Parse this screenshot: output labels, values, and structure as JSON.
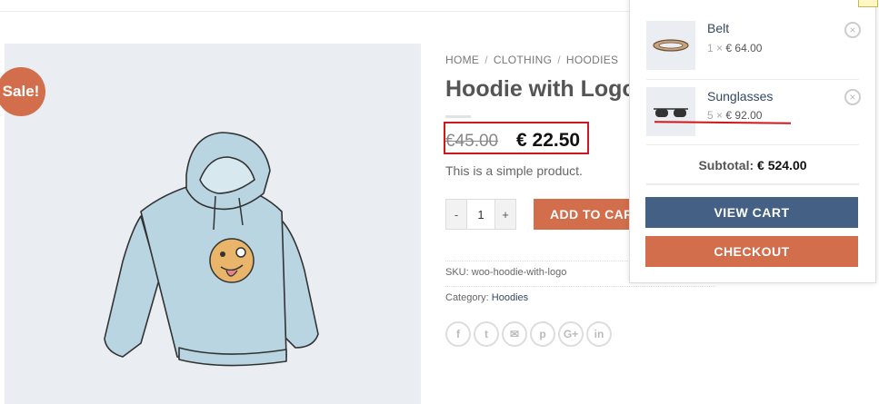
{
  "badge": {
    "sale": "Sale!"
  },
  "breadcrumb": [
    "HOME",
    "CLOTHING",
    "HOODIES"
  ],
  "breadcrumb_sep": "/",
  "product": {
    "title": "Hoodie with Logo",
    "old_price": "€45.00",
    "new_price": "€ 22.50",
    "description": "This is a simple product.",
    "qty": "1",
    "minus": "-",
    "plus": "+",
    "add_to_cart": "ADD TO CART",
    "sku_label": "SKU:",
    "sku": "woo-hoodie-with-logo",
    "category_label": "Category:",
    "category": "Hoodies"
  },
  "share": [
    "f",
    "t",
    "✉",
    "p",
    "G+",
    "in"
  ],
  "cart": {
    "items": [
      {
        "name": "Belt",
        "qty": "1",
        "price": "€ 64.00"
      },
      {
        "name": "Sunglasses",
        "qty": "5",
        "price": "€ 92.00"
      }
    ],
    "times": "×",
    "remove": "×",
    "subtotal_label": "Subtotal:",
    "subtotal": "€ 524.00",
    "view_cart": "VIEW CART",
    "checkout": "CHECKOUT"
  },
  "colors": {
    "accent": "#d26e4b",
    "primary": "#446084",
    "highlight": "#d0181b",
    "link": "#334862"
  }
}
